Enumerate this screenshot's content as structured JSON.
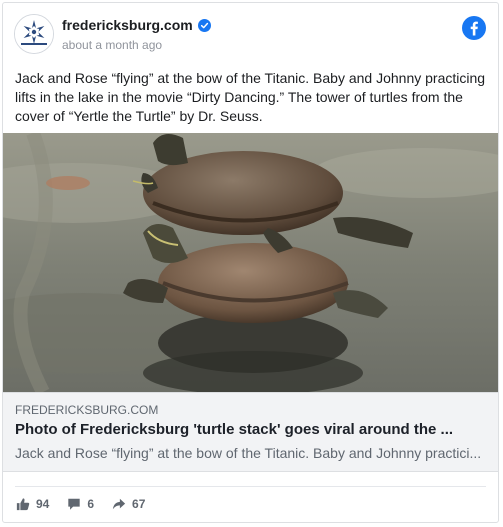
{
  "post": {
    "page_name": "fredericksburg.com",
    "timestamp": "about a month ago",
    "text": "Jack and Rose “flying” at the bow of the Titanic. Baby and Johnny practicing lifts in the lake in the movie “Dirty Dancing.” The tower of turtles from the cover of “Yertle the Turtle” by Dr. Seuss.",
    "avatar_text": "fredericksburg.com",
    "verified_icon": "verified-badge-icon",
    "platform_icon": "facebook-logo-icon"
  },
  "link": {
    "domain": "FREDERICKSBURG.COM",
    "title": "Photo of Fredericksburg 'turtle stack' goes viral around the ...",
    "description": "Jack and Rose “flying” at the bow of the Titanic. Baby and Johnny practici..."
  },
  "stats": {
    "likes": "94",
    "comments": "6",
    "shares": "67"
  },
  "colors": {
    "facebook_blue": "#1877f2",
    "brand_navy": "#2c4a7e",
    "link_box_bg": "#f2f3f5",
    "secondary_text": "#606770"
  }
}
